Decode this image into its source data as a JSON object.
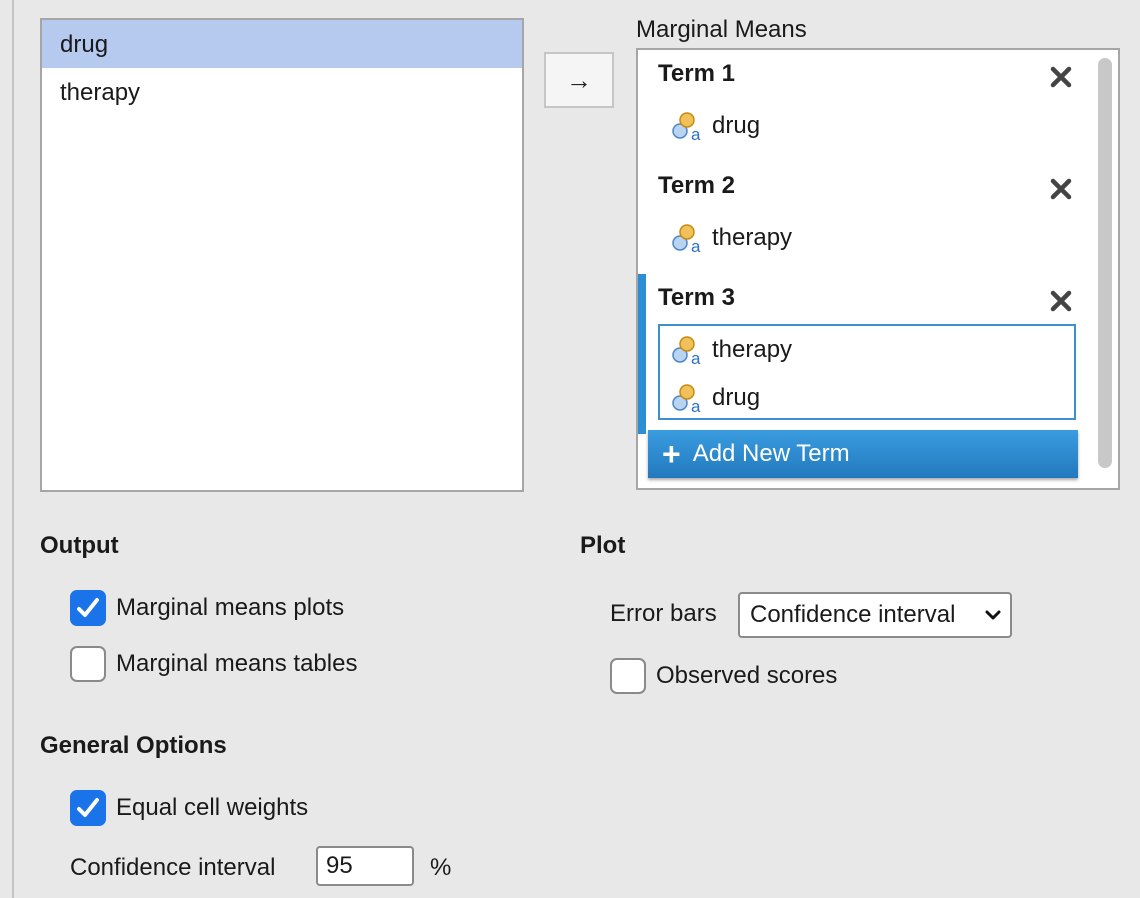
{
  "variables": [
    "drug",
    "therapy"
  ],
  "arrow_label": "→",
  "marginal_means": {
    "title": "Marginal Means",
    "terms": [
      {
        "label": "Term 1",
        "vars": [
          "drug"
        ]
      },
      {
        "label": "Term 2",
        "vars": [
          "therapy"
        ]
      },
      {
        "label": "Term 3",
        "vars": [
          "therapy",
          "drug"
        ]
      }
    ],
    "add_term_label": "Add New Term"
  },
  "output": {
    "title": "Output",
    "plots_label": "Marginal means plots",
    "plots_checked": true,
    "tables_label": "Marginal means tables",
    "tables_checked": false
  },
  "plot": {
    "title": "Plot",
    "error_bars_label": "Error bars",
    "error_bars_value": "Confidence interval",
    "observed_label": "Observed scores",
    "observed_checked": false
  },
  "general": {
    "title": "General Options",
    "equal_weights_label": "Equal cell weights",
    "equal_weights_checked": true,
    "ci_label": "Confidence interval",
    "ci_value": "95",
    "ci_unit": "%"
  },
  "colors": {
    "accent": "#1a73e8",
    "selected_row": "#b6c9ee",
    "add_button": "#2c8fd6"
  }
}
